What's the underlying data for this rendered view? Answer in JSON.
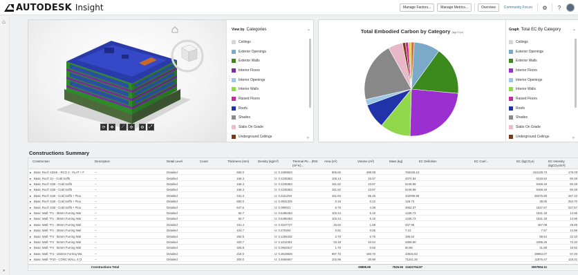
{
  "header": {
    "brand": "AUTODESK",
    "product": "Insight",
    "buttons": [
      "Manage Factors...",
      "Manage Metrics...",
      "Overview"
    ],
    "community_link": "Community Forum",
    "icons": [
      "gear-icon",
      "help-icon",
      "avatar"
    ]
  },
  "model_legend": {
    "view_by_label": "View by",
    "view_by_value": "Categories",
    "items": [
      {
        "label": "Ceilings",
        "color": "#d6d6d6"
      },
      {
        "label": "Exterior Openings",
        "color": "#7aaac8"
      },
      {
        "label": "Exterior Walls",
        "color": "#3c8a1e"
      },
      {
        "label": "Interior Floors",
        "color": "#7c2aa8"
      },
      {
        "label": "Interior Openings",
        "color": "#9cc8e8"
      },
      {
        "label": "Interior Walls",
        "color": "#8fd84a"
      },
      {
        "label": "Raised Floors",
        "color": "#c82a9a"
      },
      {
        "label": "Roofs",
        "color": "#2233aa"
      },
      {
        "label": "Shades",
        "color": "#8a8a8a"
      },
      {
        "label": "Slabs On Grade",
        "color": "#f0b8c8"
      },
      {
        "label": "Underground Ceilings",
        "color": "#7a3a1a"
      }
    ]
  },
  "viewer": {
    "toolbar_icons": [
      "orbit-icon",
      "pan-icon",
      "measure-icon",
      "explode-icon",
      "settings-icon",
      "fullscreen-icon"
    ]
  },
  "chart_panel": {
    "title": "Total Embodied Carbon by Category",
    "unit": "(kgCO₂e)",
    "graph_label": "Graph",
    "graph_value": "Total EC By Category",
    "items": [
      {
        "label": "Ceilings",
        "color": "#d6d6d6"
      },
      {
        "label": "Exterior Openings",
        "color": "#7aaac8"
      },
      {
        "label": "Exterior Walls",
        "color": "#3c8a1e"
      },
      {
        "label": "Interior Floors",
        "color": "#9b2fcf"
      },
      {
        "label": "Interior Openings",
        "color": "#9cc8e8"
      },
      {
        "label": "Interior Walls",
        "color": "#8fd84a"
      },
      {
        "label": "Raised Floors",
        "color": "#c82a9a"
      },
      {
        "label": "Roofs",
        "color": "#2233aa"
      },
      {
        "label": "Shades",
        "color": "#8a8a8a"
      },
      {
        "label": "Slabs On Grade",
        "color": "#f0b8c8"
      },
      {
        "label": "Underground Ceilings",
        "color": "#7a3a1a"
      }
    ]
  },
  "chart_data": {
    "type": "pie",
    "title": "Total Embodied Carbon by Category",
    "unit": "(kgCO₂e)",
    "categories": [
      "Exterior Openings",
      "Exterior Walls",
      "Interior Floors",
      "Interior Walls",
      "Roofs",
      "Interior Openings",
      "Shades",
      "Slabs On Grade",
      "Underground Ceilings",
      "Raised Floors",
      "Ceilings",
      "Other"
    ],
    "values": [
      9.0,
      16.5,
      24.0,
      10.5,
      8.5,
      2.0,
      20.5,
      5.0,
      1.0,
      1.0,
      1.0,
      1.0
    ],
    "colors": [
      "#7aaac8",
      "#3c8a1e",
      "#9b2fcf",
      "#8fd84a",
      "#2233aa",
      "#9cc8e8",
      "#888888",
      "#e8b8c8",
      "#7a3a1a",
      "#c82a9a",
      "#e8d03a",
      "#d66a3a"
    ],
    "legend_position": "right"
  },
  "table": {
    "title": "Constructions Summary",
    "columns": [
      "Construction",
      "Description",
      "Detail Level",
      "Count",
      "Thickness (mm)",
      "Density (kg/m³)",
      "Thermal Pe... (RSI: (m²·K)...",
      "Area (m²)",
      "Volume (m³)",
      "Mass (kg)",
      "EC Definition",
      "EC Coef...",
      "EC (kgCO₂e)",
      "EC Intensity (kgCO₂e/m²)"
    ],
    "rows": [
      [
        "Basic Roof: ADSK - RCO 2 - FLAT + F",
        "--",
        "Detailed",
        "",
        "550.0",
        "",
        "U: 0.1608503",
        "905.60",
        "498.08",
        "760235.10",
        "",
        "",
        "152129.73",
        "179.03"
      ],
      [
        "Basic Roof: S1 - Cold Soffit",
        "--",
        "Detailed",
        "",
        "156.3",
        "",
        "U: 0.2235363",
        "105.13",
        "16.57",
        "4374.84",
        "",
        "",
        "6418.52",
        "60.48"
      ],
      [
        "Basic Roof: S1B - Cold Soffit",
        "--",
        "Detailed",
        "",
        "156.3",
        "",
        "U: 0.2235363",
        "151.62",
        "23.67",
        "6249.89",
        "",
        "",
        "9169.48",
        "60.48"
      ],
      [
        "Basic Roof: S1B - Cold Soffit",
        "--",
        "Detailed",
        "",
        "156.3",
        "",
        "U: 0.2235363",
        "151.62",
        "23.67",
        "6249.89",
        "",
        "",
        "9169.48",
        "60.48"
      ],
      [
        "Basic Roof: S1B - Cold Soffit + Floo",
        "--",
        "Detailed",
        "",
        "431.3",
        "",
        "U: 0.2111294",
        "151.84",
        "65.46",
        "102096.58",
        "",
        "",
        "25375.68",
        "167.10"
      ],
      [
        "Basic Roof: S1B - Cold Soffit + Floo",
        "--",
        "Detailed",
        "",
        "650.0",
        "",
        "U: 0.0931325",
        "0.18",
        "0.12",
        "129.73",
        "",
        "",
        "38.06",
        "254.70"
      ],
      [
        "Basic Roof: S1B - Cold Soffit + Floo",
        "--",
        "Detailed",
        "",
        "647.6",
        "",
        "U: 0.090021",
        "6.76",
        "4.38",
        "4952.37",
        "",
        "",
        "1537.67",
        "227.57"
      ],
      [
        "Basic Wall: *F1 - 38mm Furring Wal",
        "--",
        "Detailed",
        "",
        "50.7",
        "",
        "U: 0.6495453",
        "102.44",
        "5.19",
        "1435.73",
        "",
        "",
        "1531.18",
        "14.95"
      ],
      [
        "Basic Wall: *F1 - 38mm Furring Wal",
        "--",
        "Detailed",
        "",
        "50.7",
        "",
        "U: 0.6495453",
        "102.44",
        "5.19",
        "1435.73",
        "",
        "",
        "1531.18",
        "14.95"
      ],
      [
        "Basic Wall: *F1 - 38mm Furring Wal",
        "--",
        "Detailed",
        "",
        "101.4",
        "",
        "U: 0.3247727",
        "15.62",
        "1.58",
        "437.96",
        "",
        "",
        "467.08",
        "29.89"
      ],
      [
        "Basic Wall: *F1 - 38mm Furring Wal",
        "--",
        "Detailed",
        "",
        "104.7",
        "",
        "U: 0.270304",
        "0.51",
        "0.05",
        "7.13",
        "",
        "",
        "7.57",
        "14.95"
      ],
      [
        "Basic Wall: *F2 - 92mm Furring Wal",
        "--",
        "Detailed",
        "",
        "282.5",
        "",
        "U: 0.1256432",
        "2.70",
        "0.76",
        "195.64",
        "",
        "",
        "59.64",
        "22.10"
      ],
      [
        "Basic Wall: *F2 - 92mm Furring Wal",
        "--",
        "Detailed",
        "",
        "320.7",
        "",
        "U: 0.1012351",
        "33.18",
        "10.64",
        "2808.80",
        "",
        "",
        "2395.29",
        "72.20"
      ],
      [
        "Basic Wall: *F2 - 92mm Furring Wal",
        "--",
        "Detailed",
        "",
        "325.8",
        "",
        "U: 0.0944817",
        "1.70",
        "0.56",
        "60.86",
        "",
        "",
        "31.88",
        "18.52"
      ],
      [
        "Basic Wall: *F4 - 150mm Furring Wa",
        "--",
        "Detailed",
        "",
        "216.0",
        "",
        "U: 0.3618526",
        "697.70",
        "150.70",
        "43545.63",
        "",
        "",
        "39963.07",
        "57.25"
      ],
      [
        "Basic Wall: *P10 - CONC WALL 4 (3",
        "--",
        "Detailed",
        "",
        "300.0",
        "",
        "U: 3.4666667",
        "102.95",
        "30.89",
        "71241.26",
        "",
        "",
        "11875.47",
        "115.31"
      ]
    ],
    "total_row": {
      "label": "Constructions Total",
      "area": "29898.68",
      "volume": "7526.55",
      "mass": "13422754.87",
      "ec": "3087804.11"
    }
  }
}
